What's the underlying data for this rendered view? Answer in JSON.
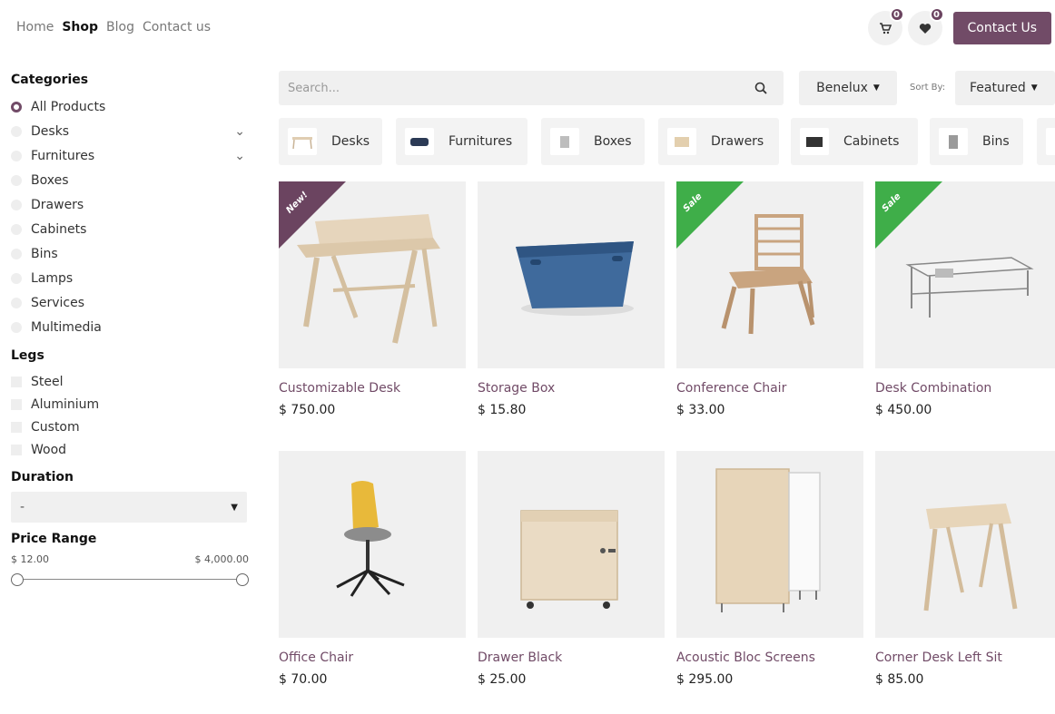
{
  "nav": {
    "items": [
      {
        "label": "Home",
        "active": false
      },
      {
        "label": "Shop",
        "active": true
      },
      {
        "label": "Blog",
        "active": false
      },
      {
        "label": "Contact us",
        "active": false
      }
    ]
  },
  "header": {
    "cart_count": "0",
    "wishlist_count": "0",
    "contact_button": "Contact Us"
  },
  "sidebar": {
    "categories_title": "Categories",
    "categories": [
      {
        "label": "All Products",
        "selected": true,
        "expandable": false
      },
      {
        "label": "Desks",
        "selected": false,
        "expandable": true
      },
      {
        "label": "Furnitures",
        "selected": false,
        "expandable": true
      },
      {
        "label": "Boxes",
        "selected": false,
        "expandable": false
      },
      {
        "label": "Drawers",
        "selected": false,
        "expandable": false
      },
      {
        "label": "Cabinets",
        "selected": false,
        "expandable": false
      },
      {
        "label": "Bins",
        "selected": false,
        "expandable": false
      },
      {
        "label": "Lamps",
        "selected": false,
        "expandable": false
      },
      {
        "label": "Services",
        "selected": false,
        "expandable": false
      },
      {
        "label": "Multimedia",
        "selected": false,
        "expandable": false
      }
    ],
    "legs_title": "Legs",
    "legs": [
      "Steel",
      "Aluminium",
      "Custom",
      "Wood"
    ],
    "duration_title": "Duration",
    "duration_value": "-",
    "price_title": "Price Range",
    "price_min": "$ 12.00",
    "price_max": "$ 4,000.00"
  },
  "toolbar": {
    "search_placeholder": "Search...",
    "region": "Benelux",
    "sort_label": "Sort By:",
    "sort_value": "Featured"
  },
  "chips": [
    "Desks",
    "Furnitures",
    "Boxes",
    "Drawers",
    "Cabinets",
    "Bins"
  ],
  "products": [
    {
      "name": "Customizable Desk",
      "price": "$ 750.00",
      "ribbon": "New!"
    },
    {
      "name": "Storage Box",
      "price": "$ 15.80",
      "ribbon": ""
    },
    {
      "name": "Conference Chair",
      "price": "$ 33.00",
      "ribbon": "Sale"
    },
    {
      "name": "Desk Combination",
      "price": "$ 450.00",
      "ribbon": "Sale"
    },
    {
      "name": "Office Chair",
      "price": "$ 70.00",
      "ribbon": ""
    },
    {
      "name": "Drawer Black",
      "price": "$ 25.00",
      "ribbon": ""
    },
    {
      "name": "Acoustic Bloc Screens",
      "price": "$ 295.00",
      "ribbon": ""
    },
    {
      "name": "Corner Desk Left Sit",
      "price": "$ 85.00",
      "ribbon": ""
    }
  ],
  "colors": {
    "brand": "#714b67",
    "ribbon_new": "#6b4460",
    "ribbon_sale": "#3fae49",
    "product_name": "#714b67"
  }
}
